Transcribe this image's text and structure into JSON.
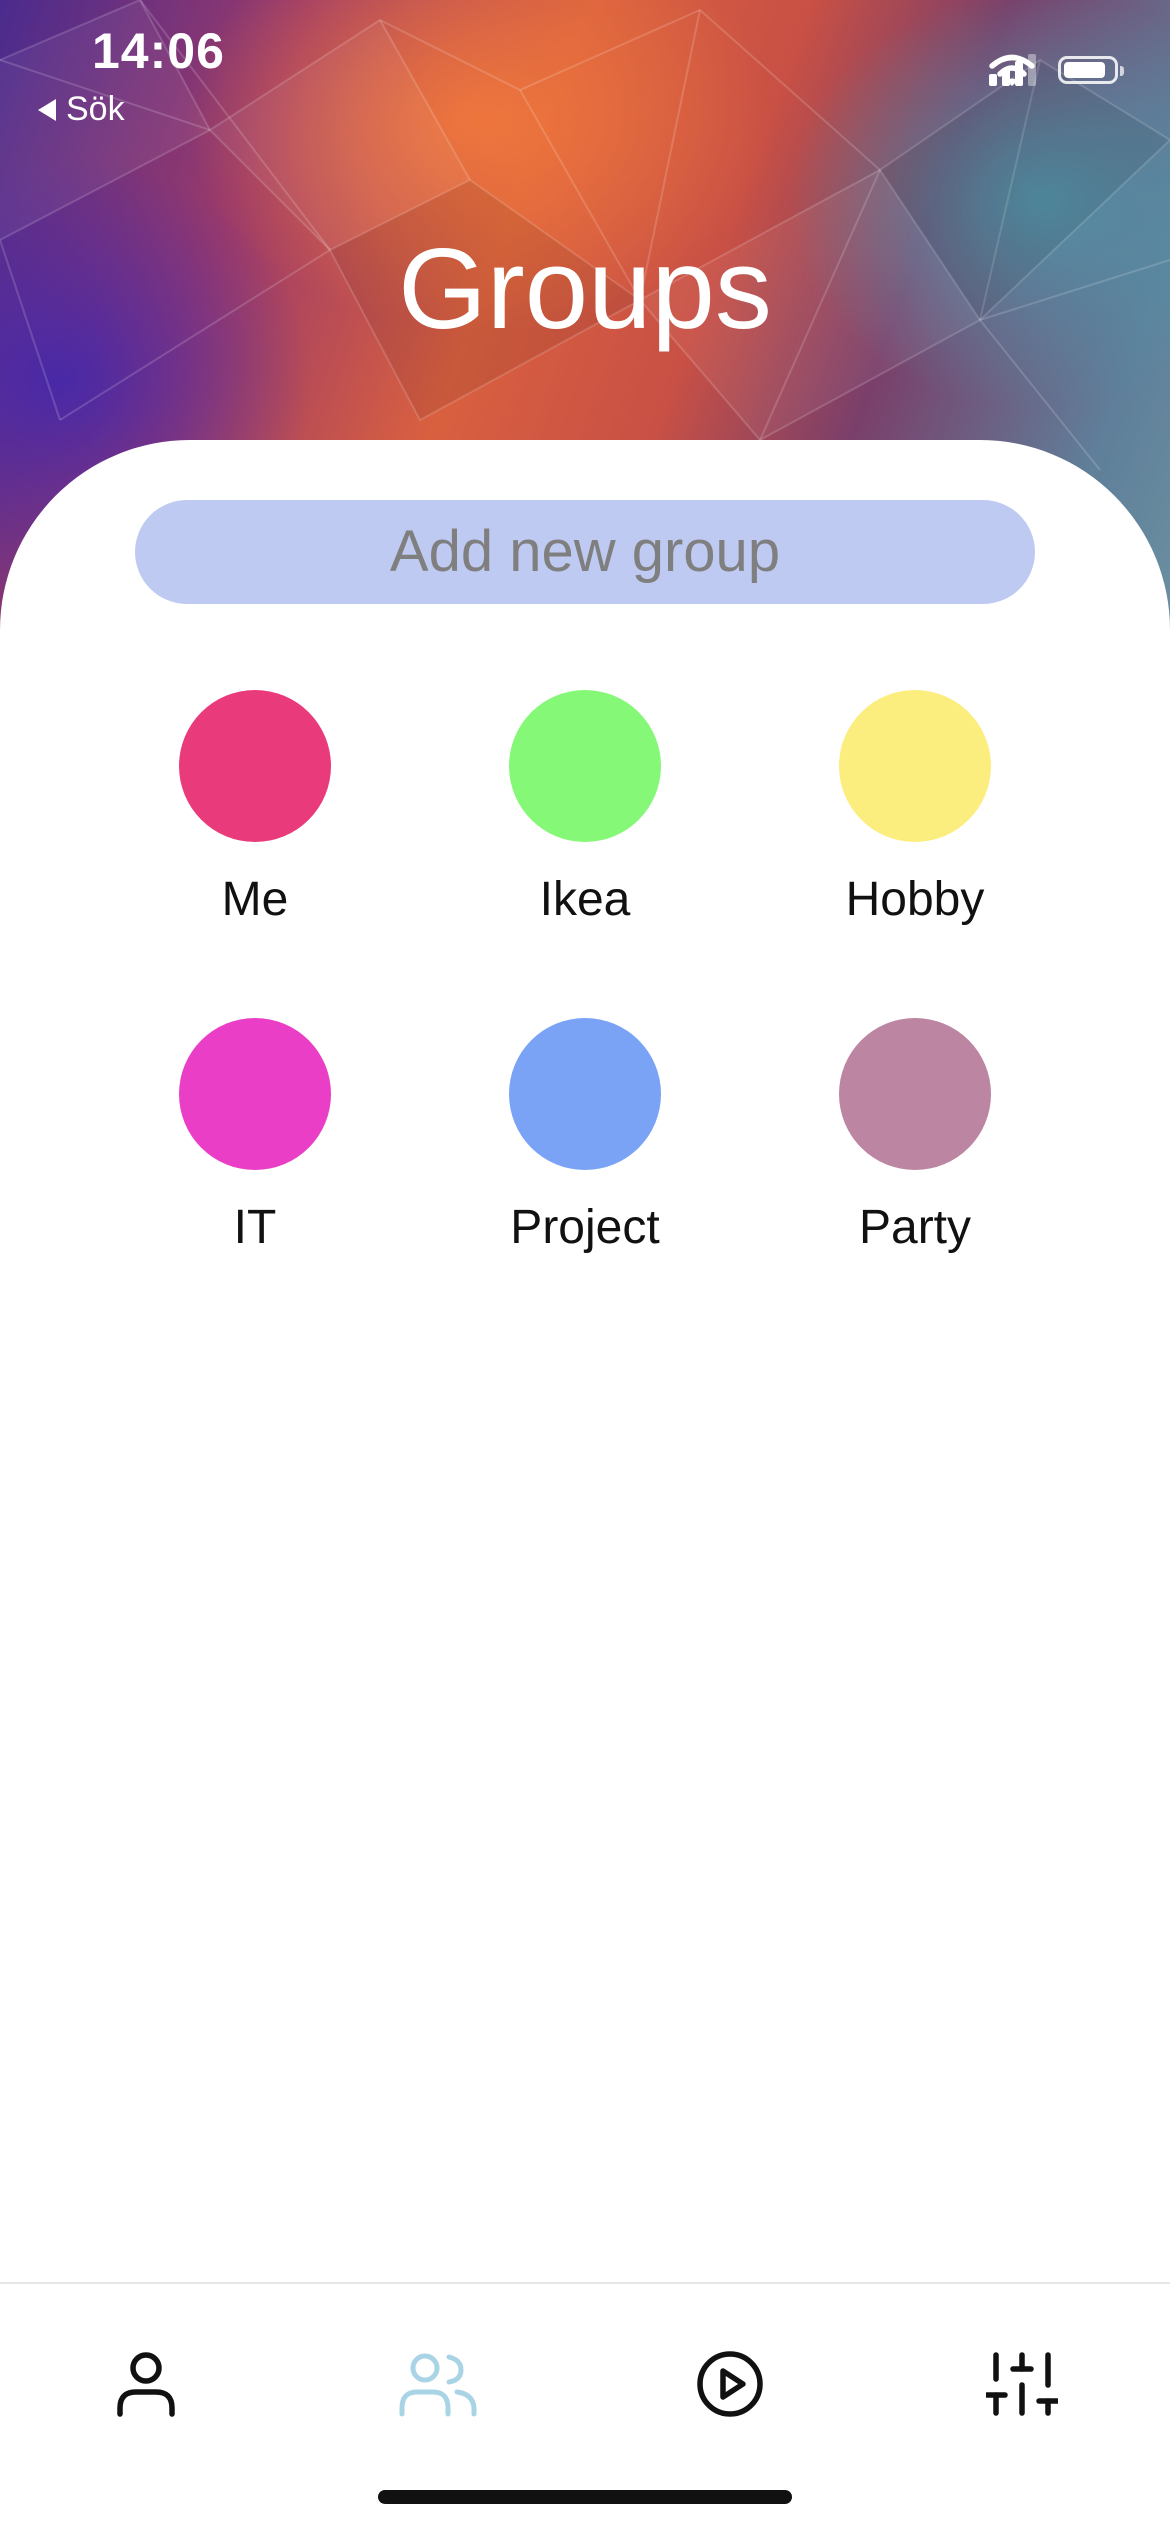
{
  "status_bar": {
    "time": "14:06",
    "back_label": "Sök",
    "signal_bars": 3,
    "battery_level_percent": 85
  },
  "header": {
    "title": "Groups"
  },
  "add_group": {
    "label": "Add new group"
  },
  "groups": [
    {
      "label": "Me",
      "color": "#e93a7c"
    },
    {
      "label": "Ikea",
      "color": "#86f877"
    },
    {
      "label": "Hobby",
      "color": "#fcee7e"
    },
    {
      "label": "IT",
      "color": "#ea3ec7"
    },
    {
      "label": "Project",
      "color": "#7ba3f5"
    },
    {
      "label": "Party",
      "color": "#bc85a1"
    }
  ],
  "tab_bar": {
    "tabs": [
      {
        "icon": "person-icon",
        "active": false
      },
      {
        "icon": "groups-icon",
        "active": true
      },
      {
        "icon": "play-icon",
        "active": false
      },
      {
        "icon": "sliders-icon",
        "active": false
      }
    ],
    "active_color": "#a9d4e6",
    "inactive_color": "#111111"
  }
}
